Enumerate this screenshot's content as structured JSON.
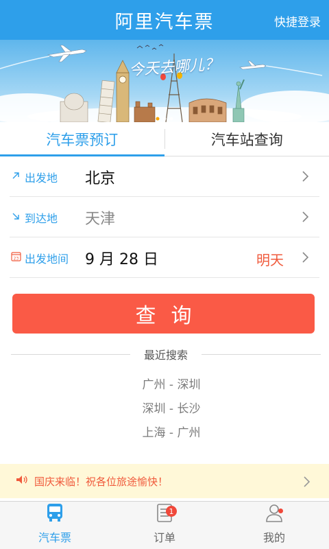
{
  "header": {
    "title": "阿里汽车票",
    "login_label": "快捷登录"
  },
  "banner": {
    "slogan": "今天去哪儿？"
  },
  "tabs": [
    {
      "label": "汽车票预订",
      "active": true
    },
    {
      "label": "汽车站查询",
      "active": false
    }
  ],
  "form": {
    "departure": {
      "label": "出发地",
      "value": "北京",
      "icon": "arrow-up-right-icon"
    },
    "arrival": {
      "label": "到达地",
      "value": "天津",
      "icon": "arrow-down-right-icon"
    },
    "date": {
      "label": "出发地间",
      "value": "9 月 28 日",
      "relative": "明天",
      "icon": "calendar-icon",
      "icon_text": "23"
    }
  },
  "search_button": {
    "label": "查询"
  },
  "recent": {
    "heading": "最近搜索",
    "items": [
      "广州 - 深圳",
      "深圳 - 长沙",
      "上海 - 广州"
    ]
  },
  "notice": {
    "text": "国庆来临！祝各位旅途愉快！",
    "icon": "speaker-icon"
  },
  "bottom_nav": [
    {
      "label": "汽车票",
      "icon": "bus-icon",
      "active": true
    },
    {
      "label": "订单",
      "icon": "order-list-icon",
      "badge": "1"
    },
    {
      "label": "我的",
      "icon": "user-icon",
      "dot": true
    }
  ],
  "colors": {
    "primary": "#2e9fea",
    "accent": "#fa5a46",
    "notice_bg": "#fff8d8"
  }
}
